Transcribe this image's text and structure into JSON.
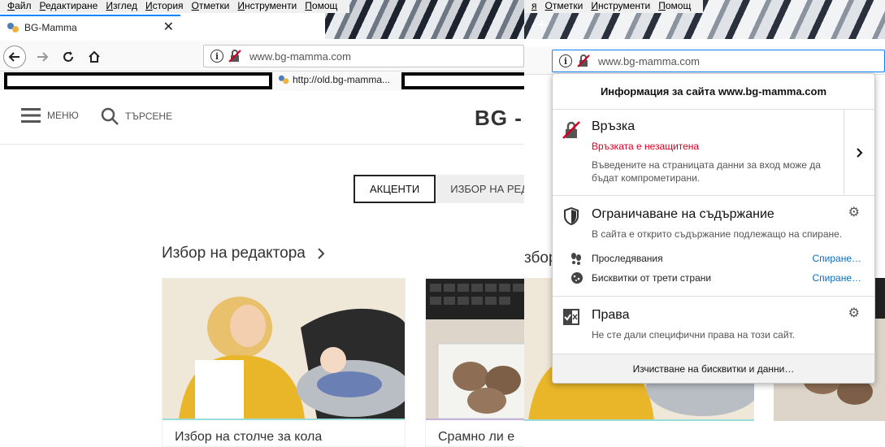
{
  "menu": {
    "items": [
      "Файл",
      "Редактиране",
      "Изглед",
      "История",
      "Отметки",
      "Инструменти",
      "Помощ"
    ],
    "right_items": [
      "я",
      "Отметки",
      "Инструменти",
      "Помощ"
    ]
  },
  "tab": {
    "title": "BG-Mamma",
    "close": "✕",
    "new_tab": "+"
  },
  "url": {
    "left": "www.bg-mamma.com",
    "right": "www.bg-mamma.com"
  },
  "bookmarks": {
    "old_site": "http://old.bg-mamma..."
  },
  "site": {
    "menu_label": "МЕНЮ",
    "search_label": "ТЪРСЕНЕ",
    "logo": "BG - ",
    "tabs": [
      "АКЦЕНТИ",
      "ИЗБОР НА РЕД"
    ],
    "section_title": "Избор на редактора",
    "section_title_partial": "збор",
    "cards": [
      "Избор на столче за кола",
      "Срамно ли е"
    ]
  },
  "popup": {
    "header": "Информация за сайта www.bg-mamma.com",
    "connection": {
      "title": "Връзка",
      "status": "Връзката е незащитена",
      "warning": "Въведените на страницата данни за вход може да бъдат компрометирани."
    },
    "blocking": {
      "title": "Ограничаване на съдържание",
      "desc": "В сайта е открито съдържание подлежащо на спиране.",
      "rows": [
        {
          "label": "Проследявания",
          "action": "Спиране…"
        },
        {
          "label": "Бисквитки от трети страни",
          "action": "Спиране…"
        }
      ]
    },
    "permissions": {
      "title": "Права",
      "desc": "Не сте дали специфични права на този сайт."
    },
    "footer": "Изчистване на бисквитки и данни…"
  },
  "colors": {
    "insecure": "#d70022",
    "link": "#0a6dcc",
    "accent": "#0a84ff"
  },
  "icons": [
    "info-icon",
    "insecure-lock-icon",
    "shield-icon",
    "gear-icon",
    "tracker-icon",
    "cookie-icon",
    "permissions-icon",
    "chevron-right-icon",
    "hamburger-icon",
    "search-icon"
  ]
}
